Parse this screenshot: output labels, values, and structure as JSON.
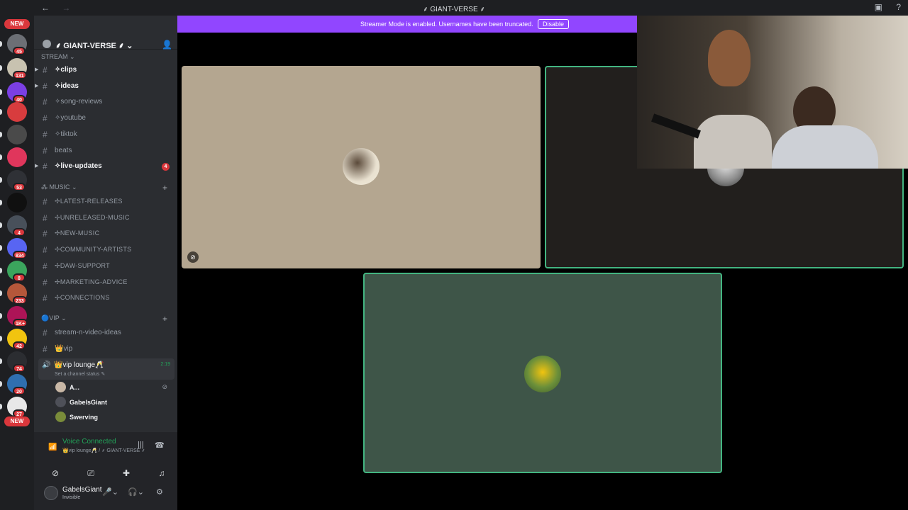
{
  "titlebar": {
    "back": "←",
    "forward": "→",
    "title": "⸙ GIANT-VERSE ⸙"
  },
  "guilds": {
    "new_top": "NEW",
    "new_bottom": "NEW",
    "items": [
      {
        "badge": "45",
        "color": "#6c6f75"
      },
      {
        "badge": "131",
        "color": "#c8c2b0"
      },
      {
        "badge": "40",
        "color": "#7b3fe4"
      },
      {
        "badge": "",
        "color": "#d83c3e"
      },
      {
        "badge": "",
        "color": "#4a4a4a"
      },
      {
        "badge": "",
        "color": "#e0365c"
      },
      {
        "badge": "53",
        "color": "#2f3136"
      },
      {
        "badge": "",
        "color": "#101010"
      },
      {
        "badge": "4",
        "color": "#48505a"
      },
      {
        "badge": "834",
        "color": "#5865f2"
      },
      {
        "badge": "8",
        "color": "#3ba55d"
      },
      {
        "badge": "233",
        "color": "#b5573a"
      },
      {
        "badge": "1K+",
        "color": "#ad1457"
      },
      {
        "badge": "42",
        "color": "#f1c40f"
      },
      {
        "badge": "74",
        "color": "#2b2d31"
      },
      {
        "badge": "20",
        "color": "#2f6fb0"
      },
      {
        "badge": "27",
        "color": "#e8e8e8"
      }
    ]
  },
  "server": {
    "name": "⸙ GIANT-VERSE ⸙"
  },
  "categories": {
    "stream": "STREAM",
    "music": "MUSIC",
    "vip": "VIP"
  },
  "channels": [
    {
      "name": "✧clips",
      "unread": true
    },
    {
      "name": "✧ideas",
      "unread": true
    },
    {
      "name": "✧song-reviews",
      "unread": false
    },
    {
      "name": "✧youtube",
      "unread": false
    },
    {
      "name": "✧tiktok",
      "unread": false
    },
    {
      "name": "beats",
      "unread": false
    },
    {
      "name": "✧live-updates",
      "unread": true,
      "mentions": "4"
    }
  ],
  "music_channels": [
    "✢LATEST-RELEASES",
    "✢UNRELEASED-MUSIC",
    "✢NEW-MUSIC",
    "✢COMMUNITY-ARTISTS",
    "✢DAW-SUPPORT",
    "✢MARKETING-ADVICE",
    "✢CONNECTIONS"
  ],
  "vip_channels": [
    "stream-n-video-ideas",
    "👑vip"
  ],
  "voice_channel": {
    "name": "👑vip lounge🥂",
    "status": "Set a channel status ✎",
    "time": "2:19"
  },
  "voice_users": [
    {
      "name": "A...",
      "color": "#c9b8a6"
    },
    {
      "name": "GabelsGiant",
      "color": "#4e5058"
    },
    {
      "name": "Swerving",
      "color": "#7a8c3a"
    }
  ],
  "voice_panel": {
    "title": "Voice Connected",
    "subtitle": "👑vip lounge🥂 / ⸙ GIANT-VERSE ⸙"
  },
  "user": {
    "name": "GabelsGiant",
    "status": "Invisible"
  },
  "banner": {
    "text": "Streamer Mode is enabled. Usernames have been truncated.",
    "button": "Disable"
  },
  "colors": {
    "tile1": "#b4a690",
    "tile2": "#221f1d",
    "tile3": "#3e5548",
    "speaking_border": "#43b581"
  }
}
